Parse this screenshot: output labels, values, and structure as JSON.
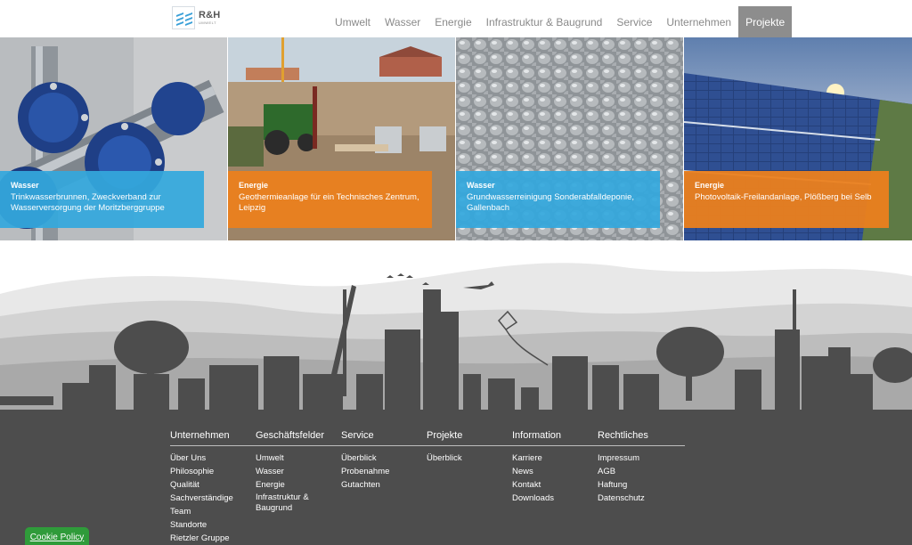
{
  "header": {
    "logo": {
      "title": "R&H",
      "subtitle": "UMWELT",
      "icon": "rh-logo-icon"
    },
    "nav": [
      {
        "label": "Umwelt"
      },
      {
        "label": "Wasser"
      },
      {
        "label": "Energie"
      },
      {
        "label": "Infrastruktur & Baugrund"
      },
      {
        "label": "Service"
      },
      {
        "label": "Unternehmen"
      },
      {
        "label": "Projekte",
        "active": true
      }
    ]
  },
  "projects": [
    {
      "category": "Wasser",
      "title": "Trinkwasserbrunnen, Zweckverband zur Wasserversorgung der Moritzberggruppe",
      "color": "#34a8dd"
    },
    {
      "category": "Energie",
      "title": "Geothermieanlage für ein Technisches Zentrum, Leipzig",
      "color": "#eb801e"
    },
    {
      "category": "Wasser",
      "title": "Grundwasserreinigung Sonderabfalldeponie, Gallenbach",
      "color": "#34a8dd"
    },
    {
      "category": "Energie",
      "title": "Photovoltaik-Freilandanlage, Plößberg bei Selb",
      "color": "#eb801e"
    }
  ],
  "footer": {
    "columns": [
      {
        "heading": "Unternehmen",
        "links": [
          "Über Uns",
          "Philosophie",
          "Qualität",
          "Sachverständige",
          "Team",
          "Standorte",
          "Rietzler Gruppe"
        ]
      },
      {
        "heading": "Geschäftsfelder",
        "links": [
          "Umwelt",
          "Wasser",
          "Energie",
          "Infrastruktur & Baugrund"
        ]
      },
      {
        "heading": "Service",
        "links": [
          "Überblick",
          "Probenahme",
          "Gutachten"
        ]
      },
      {
        "heading": "Projekte",
        "links": [
          "Überblick"
        ]
      },
      {
        "heading": "Information",
        "links": [
          "Karriere",
          "News",
          "Kontakt",
          "Downloads"
        ]
      },
      {
        "heading": "Rechtliches",
        "links": [
          "Impressum",
          "AGB",
          "Haftung",
          "Datenschutz"
        ]
      }
    ]
  },
  "cookie": {
    "label": "Cookie Policy"
  },
  "colors": {
    "water": "#34a8dd",
    "energy": "#eb801e",
    "footer": "#4d4d4d",
    "nav_active": "#8d8d8d"
  }
}
